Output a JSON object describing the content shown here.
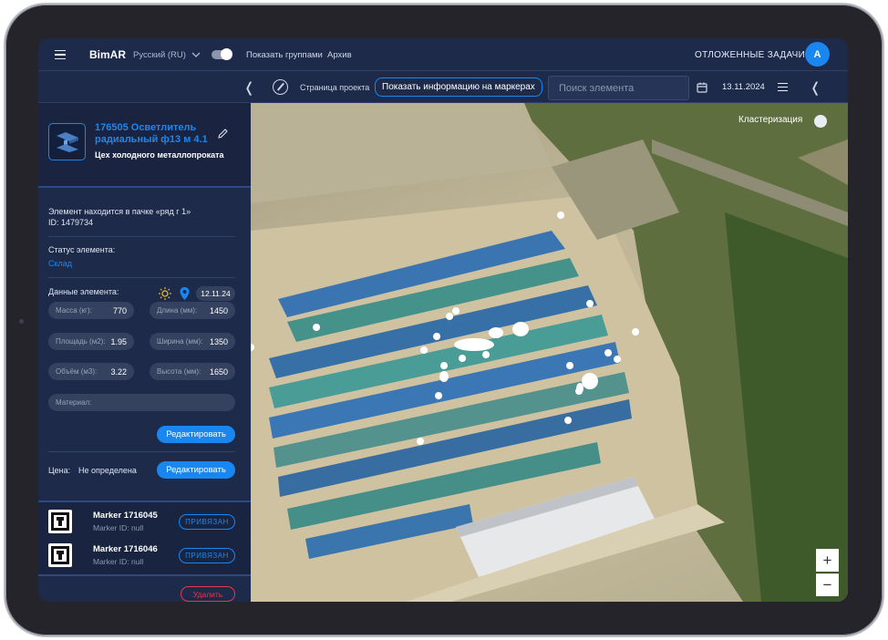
{
  "header": {
    "brand": "BimAR",
    "language": "Русский (RU)",
    "show_groups": "Показать группами",
    "archive": "Архив",
    "deferred_tasks": "ОТЛОЖЕННЫЕ ЗАДАЧИ",
    "avatar_letter": "A"
  },
  "toolbar": {
    "project_page": "Страница проекта",
    "show_marker_info": "Показать информацию на маркерах",
    "search_placeholder": "Поиск элемента",
    "date": "13.11.2024"
  },
  "element": {
    "title": "176505 Осветлитель радиальный ф13 м 4.1",
    "workshop": "Цех холодного металлопроката",
    "location_line": "Элемент находится в пачке «ряд г 1»",
    "id_line": "ID: 1479734",
    "status_label": "Статус элемента:",
    "status_value": "Склад",
    "status_date": "12.11.24",
    "data_label": "Данные элемента:",
    "fields": {
      "mass": {
        "label": "Масса (кг):",
        "value": "770"
      },
      "length": {
        "label": "Длина (мм):",
        "value": "1450"
      },
      "area": {
        "label": "Площадь (м2):",
        "value": "1.95"
      },
      "width": {
        "label": "Ширина (мм):",
        "value": "1350"
      },
      "volume": {
        "label": "Объём (м3):",
        "value": "3.22"
      },
      "height": {
        "label": "Высота (мм):",
        "value": "1650"
      },
      "material": {
        "label": "Материал:",
        "value": ""
      }
    },
    "edit_label": "Редактировать",
    "price_label": "Цена:",
    "price_value": "Не определена",
    "price_edit_label": "Редактировать"
  },
  "markers": [
    {
      "name": "Marker 1716045",
      "marker_id": "Marker ID: null",
      "status": "ПРИВЯЗАН"
    },
    {
      "name": "Marker 1716046",
      "marker_id": "Marker ID: null",
      "status": "ПРИВЯЗАН"
    }
  ],
  "delete_label": "Удалить",
  "map": {
    "clustering_label": "Кластеризация",
    "zoom_in": "+",
    "zoom_out": "−"
  },
  "colors": {
    "accent": "#1a87f0",
    "panel": "#1d2a4a",
    "danger": "#e23a4c"
  }
}
